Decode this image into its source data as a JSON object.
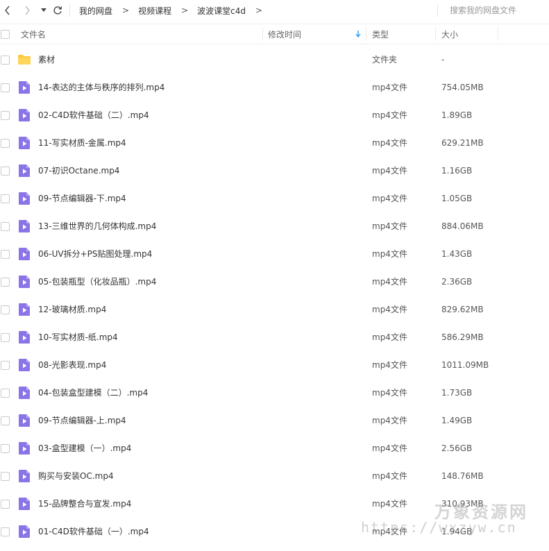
{
  "nav": {
    "breadcrumbs": [
      "我的网盘",
      "视频课程",
      "波波课堂c4d"
    ],
    "crumb_separator": ">",
    "search_placeholder": "搜索我的网盘文件"
  },
  "table": {
    "columns": {
      "name": "文件名",
      "modified": "修改时间",
      "type": "类型",
      "size": "大小"
    },
    "sort_column": "modified",
    "sort_direction": "descending"
  },
  "files": [
    {
      "name": "素材",
      "type": "文件夹",
      "size": "-",
      "icon": "folder-icon"
    },
    {
      "name": "14-表达的主体与秩序的排列.mp4",
      "type": "mp4文件",
      "size": "754.05MB",
      "icon": "video-file-icon"
    },
    {
      "name": "02-C4D软件基础（二）.mp4",
      "type": "mp4文件",
      "size": "1.89GB",
      "icon": "video-file-icon"
    },
    {
      "name": "11-写实材质-金属.mp4",
      "type": "mp4文件",
      "size": "629.21MB",
      "icon": "video-file-icon"
    },
    {
      "name": "07-初识Octane.mp4",
      "type": "mp4文件",
      "size": "1.16GB",
      "icon": "video-file-icon"
    },
    {
      "name": "09-节点编辑器-下.mp4",
      "type": "mp4文件",
      "size": "1.05GB",
      "icon": "video-file-icon"
    },
    {
      "name": "13-三维世界的几何体构成.mp4",
      "type": "mp4文件",
      "size": "884.06MB",
      "icon": "video-file-icon"
    },
    {
      "name": "06-UV拆分+PS贴图处理.mp4",
      "type": "mp4文件",
      "size": "1.43GB",
      "icon": "video-file-icon"
    },
    {
      "name": "05-包装瓶型（化妆品瓶）.mp4",
      "type": "mp4文件",
      "size": "2.36GB",
      "icon": "video-file-icon"
    },
    {
      "name": "12-玻璃材质.mp4",
      "type": "mp4文件",
      "size": "829.62MB",
      "icon": "video-file-icon"
    },
    {
      "name": "10-写实材质-纸.mp4",
      "type": "mp4文件",
      "size": "586.29MB",
      "icon": "video-file-icon"
    },
    {
      "name": "08-光影表现.mp4",
      "type": "mp4文件",
      "size": "1011.09MB",
      "icon": "video-file-icon"
    },
    {
      "name": "04-包装盒型建模（二）.mp4",
      "type": "mp4文件",
      "size": "1.73GB",
      "icon": "video-file-icon"
    },
    {
      "name": "09-节点编辑器-上.mp4",
      "type": "mp4文件",
      "size": "1.49GB",
      "icon": "video-file-icon"
    },
    {
      "name": "03-盒型建模（一）.mp4",
      "type": "mp4文件",
      "size": "2.56GB",
      "icon": "video-file-icon"
    },
    {
      "name": "购买与安装OC.mp4",
      "type": "mp4文件",
      "size": "148.76MB",
      "icon": "video-file-icon"
    },
    {
      "name": "15-品牌整合与宣发.mp4",
      "type": "mp4文件",
      "size": "310.93MB",
      "icon": "video-file-icon"
    },
    {
      "name": "01-C4D软件基础（一）.mp4",
      "type": "mp4文件",
      "size": "1.94GB",
      "icon": "video-file-icon"
    }
  ],
  "watermark": {
    "title": "万象资源网",
    "url": "https://wxzyw.cn"
  },
  "colors": {
    "folder": "#FFC93B",
    "video_icon": "#8B73E8",
    "sort_arrow": "#2D9CF0"
  }
}
